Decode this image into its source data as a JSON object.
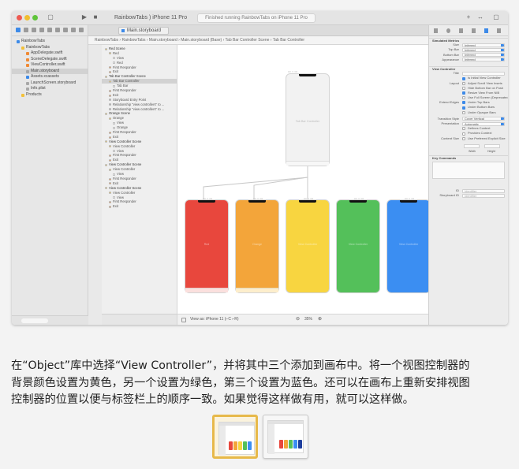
{
  "toolbar": {
    "scheme": "RainbowTabs  )  iPhone 11 Pro",
    "status": "Finished running RainbowTabs on iPhone 11 Pro"
  },
  "tab": {
    "label": "Main.storyboard"
  },
  "jumpbar": {
    "path": "RainbowTabs  ›  RainbowTabs  ›  Main.storyboard  ›  Main.storyboard (Base)  ›  Tab Bar Controller Scene  ›  Tab Bar Controller"
  },
  "navigator": {
    "items": [
      {
        "label": "RainbowTabs",
        "depth": 0,
        "icon": "blue"
      },
      {
        "label": "RainbowTabs",
        "depth": 1,
        "icon": "yellow"
      },
      {
        "label": "AppDelegate.swift",
        "depth": 2,
        "icon": "orange"
      },
      {
        "label": "SceneDelegate.swift",
        "depth": 2,
        "icon": "orange"
      },
      {
        "label": "ViewController.swift",
        "depth": 2,
        "icon": "orange"
      },
      {
        "label": "Main.storyboard",
        "depth": 2,
        "icon": "gray",
        "selected": true
      },
      {
        "label": "Assets.xcassets",
        "depth": 2,
        "icon": "blue"
      },
      {
        "label": "LaunchScreen.storyboard",
        "depth": 2,
        "icon": "gray"
      },
      {
        "label": "Info.plist",
        "depth": 2,
        "icon": "gray"
      },
      {
        "label": "Products",
        "depth": 1,
        "icon": "yellow"
      }
    ]
  },
  "outline": {
    "rows": [
      {
        "label": "Red Scene",
        "depth": 0,
        "icon": "yellow",
        "scene": true
      },
      {
        "label": "Red",
        "depth": 1,
        "icon": "yellow"
      },
      {
        "label": "View",
        "depth": 2,
        "icon": "white"
      },
      {
        "label": "Red",
        "depth": 2,
        "icon": "white"
      },
      {
        "label": "First Responder",
        "depth": 1,
        "icon": "orange"
      },
      {
        "label": "Exit",
        "depth": 1,
        "icon": "orange"
      },
      {
        "label": "Tab Bar Controller Scene",
        "depth": 0,
        "icon": "yellow",
        "scene": true
      },
      {
        "label": "Tab Bar Controller",
        "depth": 1,
        "icon": "yellow",
        "selected": true
      },
      {
        "label": "Tab Bar",
        "depth": 2,
        "icon": "white"
      },
      {
        "label": "First Responder",
        "depth": 1,
        "icon": "orange"
      },
      {
        "label": "Exit",
        "depth": 1,
        "icon": "orange"
      },
      {
        "label": "Storyboard Entry Point",
        "depth": 1,
        "icon": "gray"
      },
      {
        "label": "Relationship \"view controllers\" to ...",
        "depth": 1,
        "icon": "gray"
      },
      {
        "label": "Relationship \"view controllers\" to ...",
        "depth": 1,
        "icon": "gray"
      },
      {
        "label": "Orange Scene",
        "depth": 0,
        "icon": "yellow",
        "scene": true
      },
      {
        "label": "Orange",
        "depth": 1,
        "icon": "yellow"
      },
      {
        "label": "View",
        "depth": 2,
        "icon": "white"
      },
      {
        "label": "Orange",
        "depth": 2,
        "icon": "white"
      },
      {
        "label": "First Responder",
        "depth": 1,
        "icon": "orange"
      },
      {
        "label": "Exit",
        "depth": 1,
        "icon": "orange"
      },
      {
        "label": "View Controller Scene",
        "depth": 0,
        "icon": "yellow",
        "scene": true
      },
      {
        "label": "View Controller",
        "depth": 1,
        "icon": "yellow"
      },
      {
        "label": "View",
        "depth": 2,
        "icon": "white"
      },
      {
        "label": "First Responder",
        "depth": 1,
        "icon": "orange"
      },
      {
        "label": "Exit",
        "depth": 1,
        "icon": "orange"
      },
      {
        "label": "View Controller Scene",
        "depth": 0,
        "icon": "yellow",
        "scene": true
      },
      {
        "label": "View Controller",
        "depth": 1,
        "icon": "yellow"
      },
      {
        "label": "View",
        "depth": 2,
        "icon": "white"
      },
      {
        "label": "First Responder",
        "depth": 1,
        "icon": "orange"
      },
      {
        "label": "Exit",
        "depth": 1,
        "icon": "orange"
      },
      {
        "label": "View Controller Scene",
        "depth": 0,
        "icon": "yellow",
        "scene": true
      },
      {
        "label": "View Controller",
        "depth": 1,
        "icon": "yellow"
      },
      {
        "label": "View",
        "depth": 2,
        "icon": "white"
      },
      {
        "label": "First Responder",
        "depth": 1,
        "icon": "orange"
      },
      {
        "label": "Exit",
        "depth": 1,
        "icon": "orange"
      }
    ]
  },
  "canvas": {
    "tab_bar_controller_label": "Tab Bar Controller",
    "scene_colors": [
      "#e8473d",
      "#f3a53a",
      "#f8d540",
      "#54c05a",
      "#3b8ef2"
    ],
    "scene_captions": [
      "Red",
      "Orange",
      "View Controller",
      "View Controller",
      "View Controller"
    ]
  },
  "canvas_bar": {
    "view_as": "View as: iPhone 11 (⌐C ⌐R)",
    "zoom": "35%"
  },
  "inspector": {
    "section_metrics": "Simulated Metrics",
    "metrics": [
      {
        "label": "Size",
        "value": "Inferred"
      },
      {
        "label": "Top Bar",
        "value": "Inferred"
      },
      {
        "label": "Bottom Bar",
        "value": "Inferred"
      },
      {
        "label": "Appearance",
        "value": "Inferred"
      }
    ],
    "section_vc": "View Controller",
    "title_label": "Title",
    "checks": [
      {
        "group": "",
        "label": "Is Initial View Controller",
        "on": true
      },
      {
        "group": "Layout",
        "label": "Adjust Scroll View Insets",
        "on": false
      },
      {
        "group": "",
        "label": "Hide Bottom Bar on Push",
        "on": false
      },
      {
        "group": "",
        "label": "Resize View From NIB",
        "on": true
      },
      {
        "group": "",
        "label": "Use Full Screen (Deprecated)",
        "on": false
      },
      {
        "group": "Extend Edges",
        "label": "Under Top Bars",
        "on": true
      },
      {
        "group": "",
        "label": "Under Bottom Bars",
        "on": true
      },
      {
        "group": "",
        "label": "Under Opaque Bars",
        "on": false
      }
    ],
    "presentation": [
      {
        "label": "Transition Style",
        "value": "Cover Vertical"
      },
      {
        "label": "Presentation",
        "value": "Automatic"
      }
    ],
    "context_checks": [
      {
        "label": "Defines Context",
        "on": false
      },
      {
        "label": "Provides Context",
        "on": false
      }
    ],
    "content_size_label": "Content Size",
    "content_size_value": "Use Preferred Explicit Size",
    "width_label": "Width",
    "height_label": "Height",
    "key_commands_label": "Key Commands",
    "id_label": "ID",
    "id_value": "Identifier",
    "sbid_label": "Storyboard ID",
    "sbid_value": "Identifier"
  },
  "caption": {
    "line1": "在“Object”库中选择“View Controller”，并将其中三个添加到画布中。将一个视图控制器的",
    "line2": "背景颜色设置为黄色，另一个设置为绿色，第三个设置为蓝色。还可以在画布上重新安排视图",
    "line3": "控制器的位置以便与标签栏上的顺序一致。如果觉得这样做有用，就可以这样做。"
  },
  "thumbnails": [
    {
      "name": "step-thumbnail-1",
      "active": true
    },
    {
      "name": "step-thumbnail-2",
      "active": false
    }
  ]
}
